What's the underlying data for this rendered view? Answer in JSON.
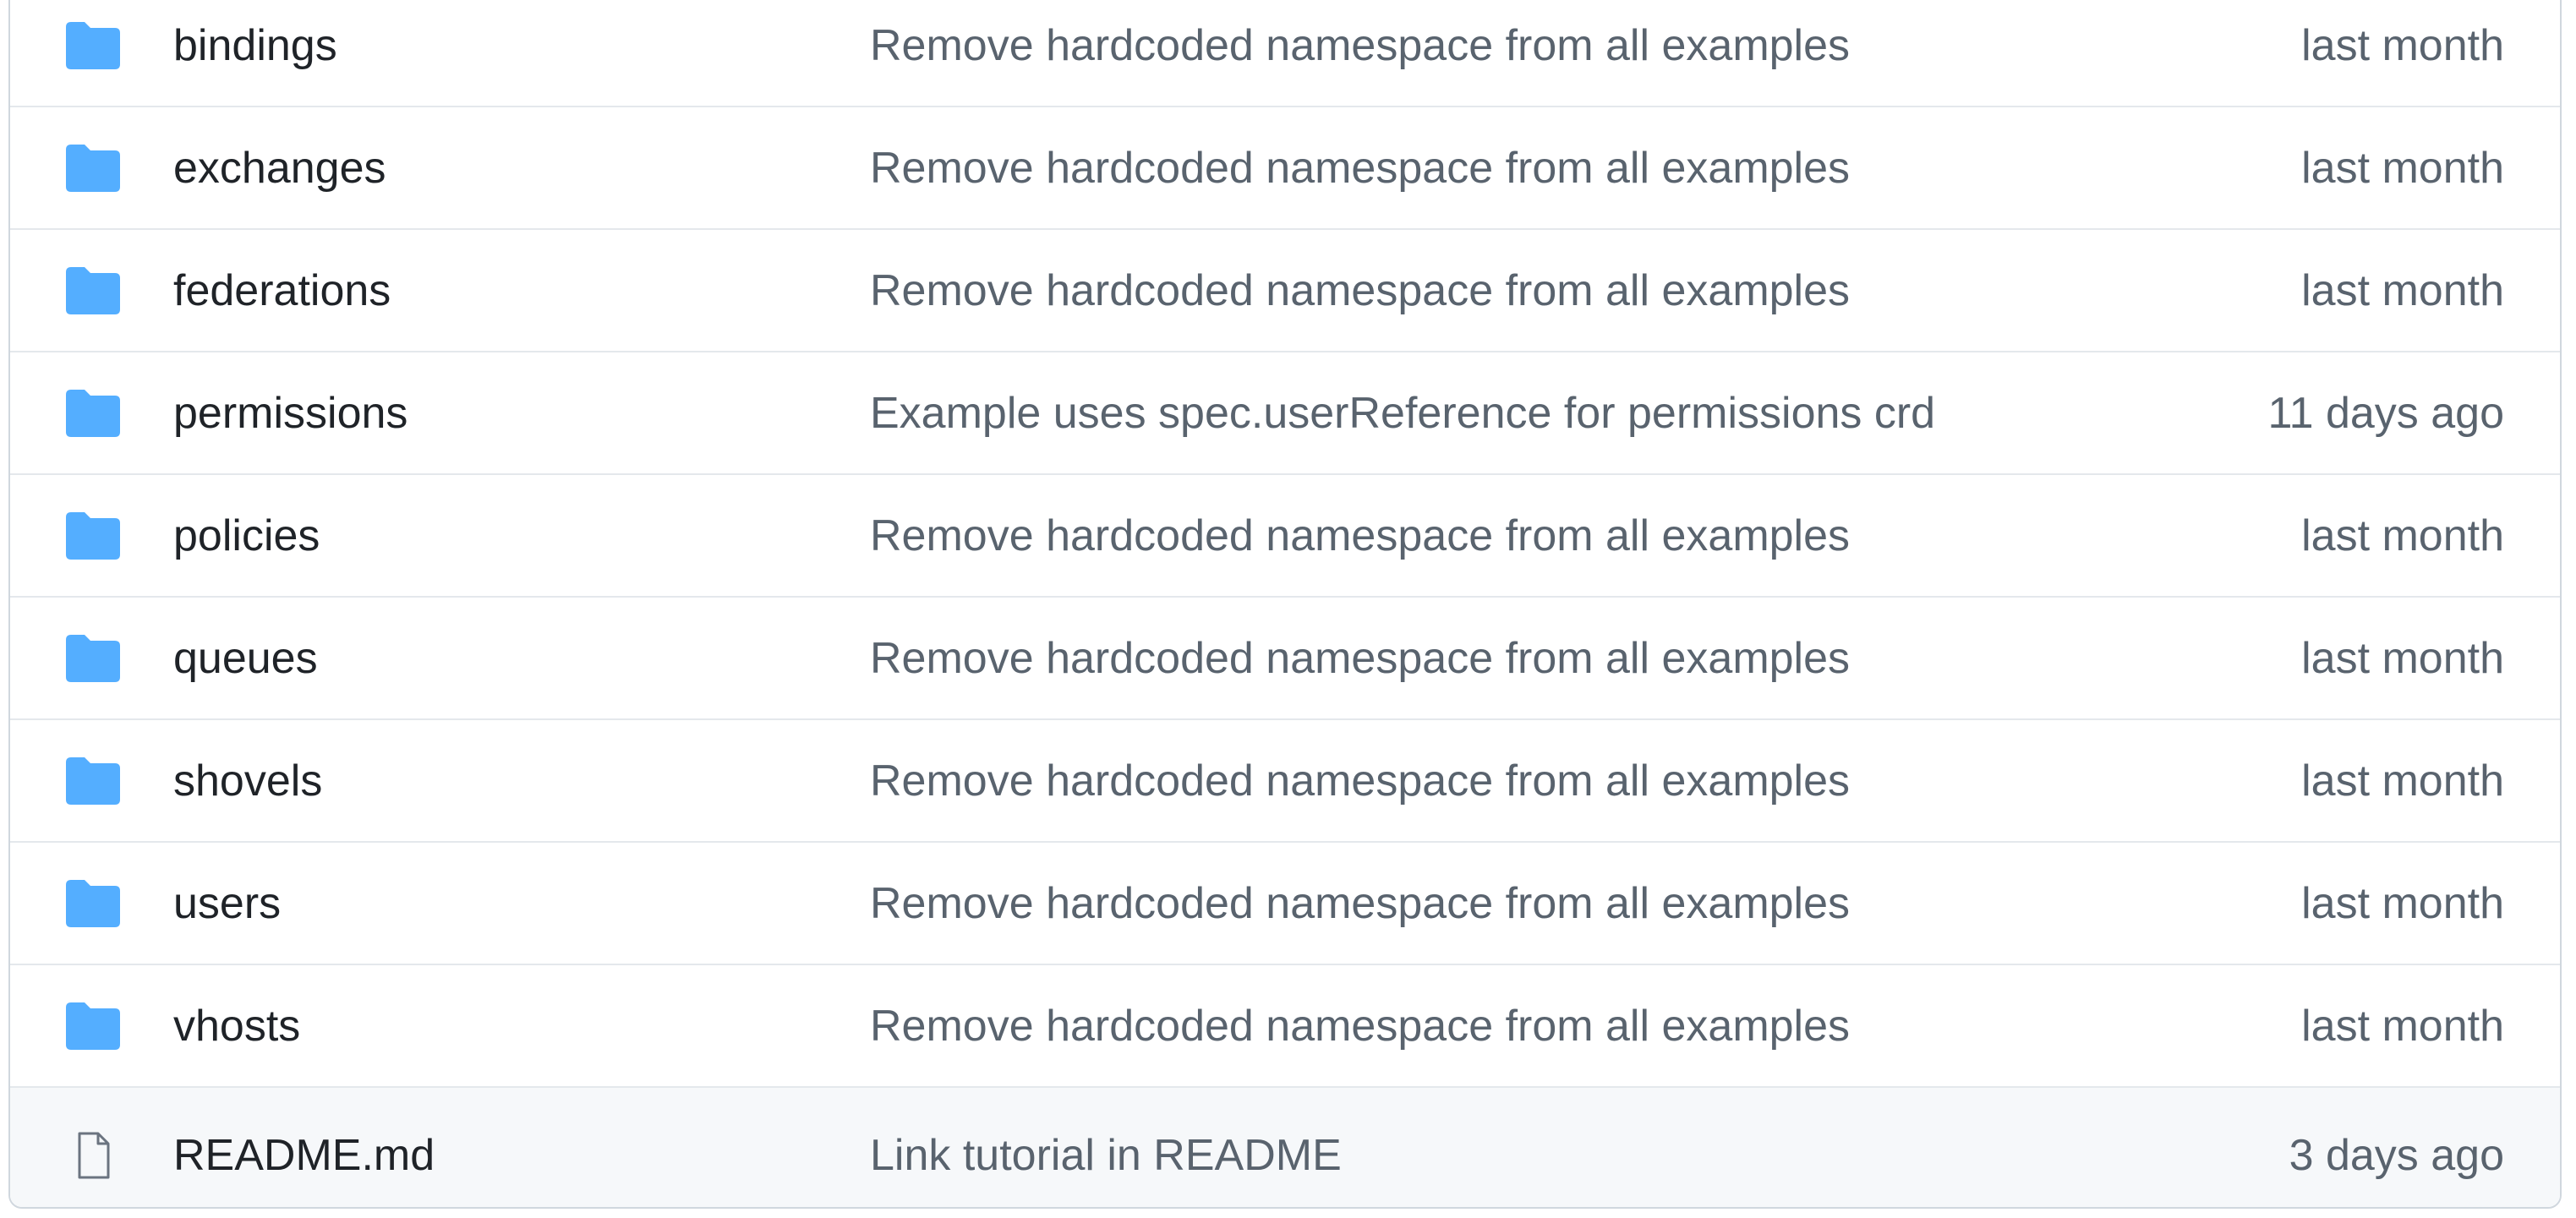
{
  "colors": {
    "folder_icon": "#54aeff",
    "file_icon": "#6b7480",
    "name_text": "#1f2328",
    "muted_text": "#59636e",
    "border": "#d0d7de",
    "footer_row_bg": "#f6f8fa"
  },
  "rows": [
    {
      "type": "folder",
      "icon": "folder-icon",
      "name": "bindings",
      "message": "Remove hardcoded namespace from all examples",
      "age": "last month"
    },
    {
      "type": "folder",
      "icon": "folder-icon",
      "name": "exchanges",
      "message": "Remove hardcoded namespace from all examples",
      "age": "last month"
    },
    {
      "type": "folder",
      "icon": "folder-icon",
      "name": "federations",
      "message": "Remove hardcoded namespace from all examples",
      "age": "last month"
    },
    {
      "type": "folder",
      "icon": "folder-icon",
      "name": "permissions",
      "message": "Example uses spec.userReference for permissions crd",
      "age": "11 days ago"
    },
    {
      "type": "folder",
      "icon": "folder-icon",
      "name": "policies",
      "message": "Remove hardcoded namespace from all examples",
      "age": "last month"
    },
    {
      "type": "folder",
      "icon": "folder-icon",
      "name": "queues",
      "message": "Remove hardcoded namespace from all examples",
      "age": "last month"
    },
    {
      "type": "folder",
      "icon": "folder-icon",
      "name": "shovels",
      "message": "Remove hardcoded namespace from all examples",
      "age": "last month"
    },
    {
      "type": "folder",
      "icon": "folder-icon",
      "name": "users",
      "message": "Remove hardcoded namespace from all examples",
      "age": "last month"
    },
    {
      "type": "folder",
      "icon": "folder-icon",
      "name": "vhosts",
      "message": "Remove hardcoded namespace from all examples",
      "age": "last month"
    },
    {
      "type": "file",
      "icon": "file-icon",
      "name": "README.md",
      "message": "Link tutorial in README",
      "age": "3 days ago"
    }
  ]
}
